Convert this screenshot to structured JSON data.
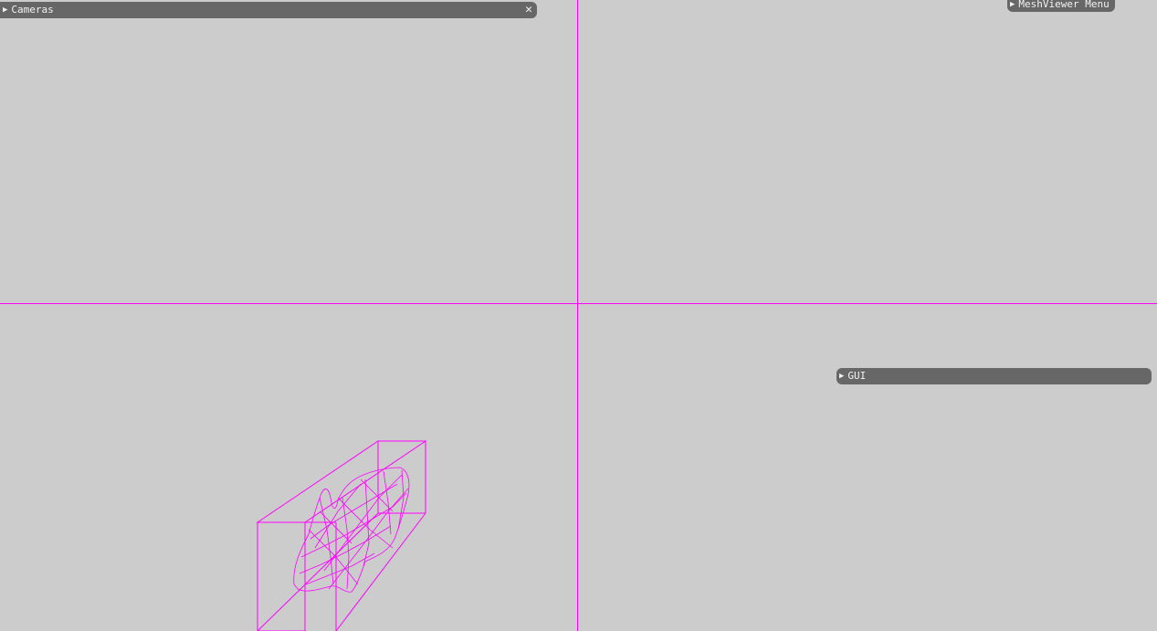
{
  "colors": {
    "background": "#cccccc",
    "accent": "#ff00ff",
    "panel": "#676767",
    "panel_text": "#f2f2f2"
  },
  "cameras_panel": {
    "arrow_icon": "triangle-right",
    "title": "Cameras",
    "close_icon": "x"
  },
  "meshviewer_panel": {
    "arrow_icon": "triangle-right",
    "title": "MeshViewer Menu"
  },
  "gui_panel": {
    "arrow_icon": "triangle-right",
    "title": "GUI"
  }
}
